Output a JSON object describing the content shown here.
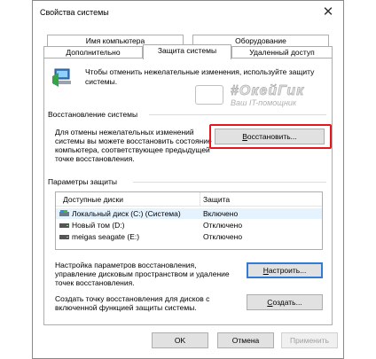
{
  "window": {
    "title": "Свойства системы"
  },
  "tabs_top": [
    "Имя компьютера",
    "Оборудование"
  ],
  "tabs_bottom": [
    "Дополнительно",
    "Защита системы",
    "Удаленный доступ"
  ],
  "intro_text": "Чтобы отменить нежелательные изменения, используйте защиту системы.",
  "watermark": {
    "title": "#ОкейГик",
    "subtitle": "Ваш IT-помощник"
  },
  "restore": {
    "section_label": "Восстановление системы",
    "description": "Для отмены нежелательных изменений системы вы можете восстановить состояние компьютера, соответствующее предыдущей точке восстановления.",
    "button_label_u": "В",
    "button_label_rest": "осстановить...",
    "highlight_color": "#e8161b"
  },
  "protection": {
    "section_label": "Параметры защиты",
    "columns": [
      "Доступные диски",
      "Защита"
    ],
    "rows": [
      {
        "name": "Локальный диск (C:) (Система)",
        "status": "Включено",
        "icon": "system-drive-icon"
      },
      {
        "name": "Новый том (D:)",
        "status": "Отключено",
        "icon": "drive-icon"
      },
      {
        "name": "meigas seagate (E:)",
        "status": "Отключено",
        "icon": "drive-icon"
      }
    ],
    "configure_text": "Настройка параметров восстановления, управление дисковым пространством и удаление точек восстановления.",
    "configure_button_u": "Н",
    "configure_button_rest": "астроить...",
    "create_text": "Создать точку восстановления для дисков с включенной функцией защиты системы.",
    "create_button_u": "С",
    "create_button_rest": "оздать..."
  },
  "footer": {
    "ok": "OK",
    "cancel": "Отмена",
    "apply": "Применить"
  }
}
